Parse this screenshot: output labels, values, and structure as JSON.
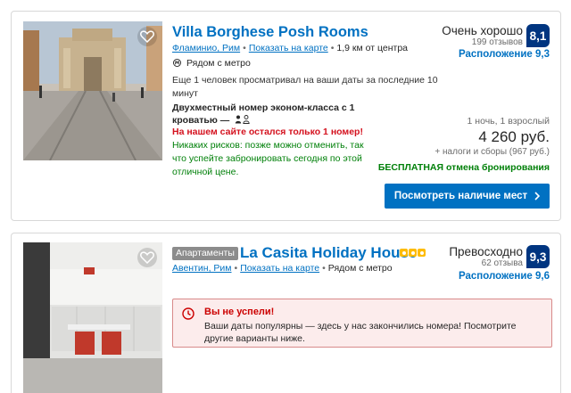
{
  "listings": [
    {
      "name": "Villa Borghese Posh Rooms",
      "district": "Фламинио, Рим",
      "map_link": "Показать на карте",
      "distance": "1,9 км от центра",
      "metro": "Рядом с метро",
      "viewers": "Еще 1 человек просматривал на ваши даты за последние 10 минут",
      "room": "Двухместный номер эконом-класса с 1 кроватью —",
      "scarcity": "На нашем сайте остался только 1 номер!",
      "no_risk": "Никаких рисков: позже можно отменить, так что успейте забронировать сегодня по этой отличной цене.",
      "review_word": "Очень хорошо",
      "review_count": "199 отзывов",
      "score": "8,1",
      "location_score": "Расположение 9,3",
      "nights": "1 ночь, 1 взрослый",
      "price": "4 260 руб.",
      "taxes": "+ налоги и сборы (967 руб.)",
      "free_cancel": "БЕСПЛАТНАЯ отмена бронирования",
      "cta": "Посмотреть наличие мест"
    },
    {
      "tag": "Апартаменты",
      "name": "La Casita Holiday House",
      "stars": 3,
      "district": "Авентин, Рим",
      "map_link": "Показать на карте",
      "metro": "Рядом с метро",
      "review_word": "Превосходно",
      "review_count": "62 отзыва",
      "score": "9,3",
      "location_score": "Расположение 9,6",
      "alert_title": "Вы не успели!",
      "alert_text": "Ваши даты популярны — здесь у нас закончились номера! Посмотрите другие варианты ниже."
    }
  ],
  "colors": {
    "link": "#0071c2",
    "score_bg": "#003580",
    "green": "#008009",
    "red": "#d4111e",
    "star": "#febb02"
  },
  "icons": [
    "heart-icon",
    "metro-icon",
    "person-icon",
    "chevron-right-icon",
    "clock-icon",
    "star-icon"
  ]
}
